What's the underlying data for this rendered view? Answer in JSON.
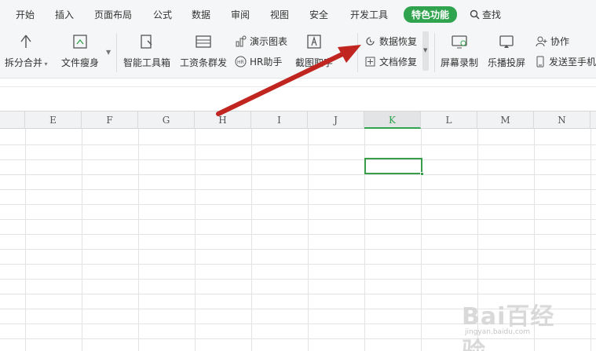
{
  "menu": {
    "tabs": [
      "开始",
      "插入",
      "页面布局",
      "公式",
      "数据",
      "审阅",
      "视图",
      "安全",
      "开发工具"
    ],
    "active_tab": "特色功能",
    "search_label": "查找",
    "active_color": "#2fa34e"
  },
  "ribbon": {
    "split_merge": "拆分合并",
    "file_slim": "文件瘦身",
    "smart_toolbox": "智能工具箱",
    "payslip": "工资条群发",
    "demo_chart": "演示图表",
    "hr_assistant": "HR助手",
    "screenshot": "截图取字",
    "data_recovery": "数据恢复",
    "doc_repair": "文档修复",
    "screen_record": "屏幕录制",
    "cast": "乐播投屏",
    "collab": "协作",
    "send_to_phone": "发送至手机"
  },
  "sheet": {
    "columns": [
      "E",
      "F",
      "G",
      "H",
      "I",
      "J",
      "K",
      "L",
      "M",
      "N"
    ],
    "selected_column": "K",
    "accent": "#2fa34e"
  },
  "annotation": {
    "arrow_color": "#c0251f"
  },
  "watermark": {
    "main": "Bai百经验",
    "sub": "jingyan.baidu.com"
  }
}
